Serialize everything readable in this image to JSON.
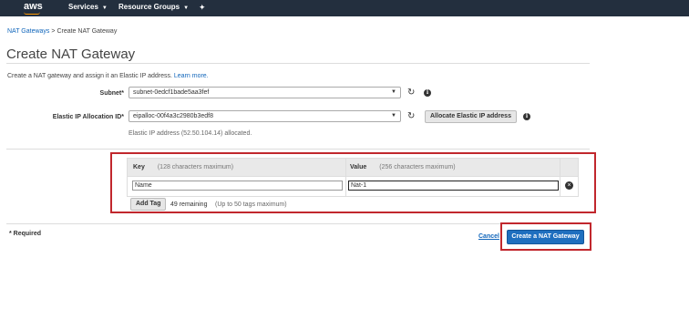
{
  "nav": {
    "logo": "aws",
    "services": "Services",
    "resource_groups": "Resource Groups",
    "pin_icon": "pushpin-icon"
  },
  "breadcrumb": {
    "link": "NAT Gateways",
    "separator": ">",
    "current": "Create NAT Gateway"
  },
  "page": {
    "title": "Create NAT Gateway",
    "description": "Create a NAT gateway and assign it an Elastic IP address.",
    "learn_more": "Learn more."
  },
  "form": {
    "subnet_label": "Subnet*",
    "subnet_value": "subnet-0edcf1bade5aa3fef",
    "eip_label": "Elastic IP Allocation ID*",
    "eip_value": "eipalloc-00f4a3c2980b3edf8",
    "allocate_button": "Allocate Elastic IP address",
    "eip_note": "Elastic IP address (52.50.104.14) allocated."
  },
  "tags": {
    "key_header": "Key",
    "key_hint": "(128 characters maximum)",
    "value_header": "Value",
    "value_hint": "(256 characters maximum)",
    "rows": [
      {
        "key": "Name",
        "value": "Nat-1"
      }
    ],
    "add_tag": "Add Tag",
    "remaining": "49 remaining",
    "max_note": "(Up to 50 tags maximum)"
  },
  "footer": {
    "required": "* Required",
    "cancel": "Cancel",
    "create": "Create a NAT Gateway"
  },
  "colors": {
    "nav_bg": "#232f3e",
    "link": "#1166bb",
    "primary": "#1f6fbf",
    "highlight_box": "#c1272d"
  }
}
